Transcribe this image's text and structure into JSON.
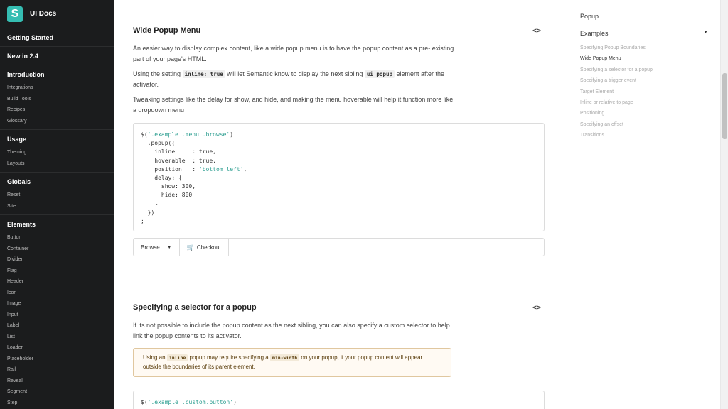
{
  "app": {
    "logo_letter": "S",
    "name": "UI Docs"
  },
  "sidebar": {
    "top_links": [
      "Getting Started",
      "New in 2.4"
    ],
    "sections": [
      {
        "title": "Introduction",
        "items": [
          "Integrations",
          "Build Tools",
          "Recipes",
          "Glossary"
        ]
      },
      {
        "title": "Usage",
        "items": [
          "Theming",
          "Layouts"
        ]
      },
      {
        "title": "Globals",
        "items": [
          "Reset",
          "Site"
        ]
      },
      {
        "title": "Elements",
        "items": [
          "Button",
          "Container",
          "Divider",
          "Flag",
          "Header",
          "Icon",
          "Image",
          "Input",
          "Label",
          "List",
          "Loader",
          "Placeholder",
          "Rail",
          "Reveal",
          "Segment",
          "Step"
        ]
      }
    ]
  },
  "section1": {
    "title": "Wide Popup Menu",
    "code_toggle": "<>",
    "p1": "An easier way to display complex content, like a wide popup menu is to have the popup content as a pre- existing part of your page's HTML.",
    "p2_before": "Using the setting",
    "p2_code1": "inline: true",
    "p2_mid": "will let Semantic know to display the next sibling",
    "p2_code2": "ui popup",
    "p2_after": "element after the activator.",
    "p3": "Tweaking settings like the delay for show, and hide, and making the menu hoverable will help it function more like a dropdown menu",
    "code": {
      "l1a": "$(",
      "l1s": "'.example .menu .browse'",
      "l1b": ")",
      "l2": "  .popup({",
      "l3": "    inline     : true,",
      "l4": "    hoverable  : true,",
      "l5a": "    position   : ",
      "l5s": "'bottom left'",
      "l5b": ",",
      "l6": "    delay: {",
      "l7": "      show: 300,",
      "l8": "      hide: 800",
      "l9": "    }",
      "l10": "  })",
      "l11": ";"
    },
    "demo": {
      "browse": "Browse",
      "checkout": "Checkout"
    }
  },
  "section2": {
    "title": "Specifying a selector for a popup",
    "code_toggle": "<>",
    "p1": "If its not possible to include the popup content as the next sibling, you can also specify a custom selector to help link the popup contents to its activator.",
    "warning_a": "Using an",
    "warning_code1": "inline",
    "warning_b": "popup may require specifying a",
    "warning_code2": "min-width",
    "warning_c": "on your popup, if your popup content will appear outside the boundaries of its parent element.",
    "code_l1a": "$(",
    "code_l1s": "'.example .custom.button'",
    "code_l1b": ")"
  },
  "toc": {
    "title": "Popup",
    "examples": "Examples",
    "items": [
      "Specifying Popup Boundaries",
      "Wide Popup Menu",
      "Specifying a selector for a popup",
      "Specifying a trigger event",
      "Target Element",
      "Inline or relative to page",
      "Positioning",
      "Specifying an offset",
      "Transitions"
    ],
    "active_index": 1
  }
}
